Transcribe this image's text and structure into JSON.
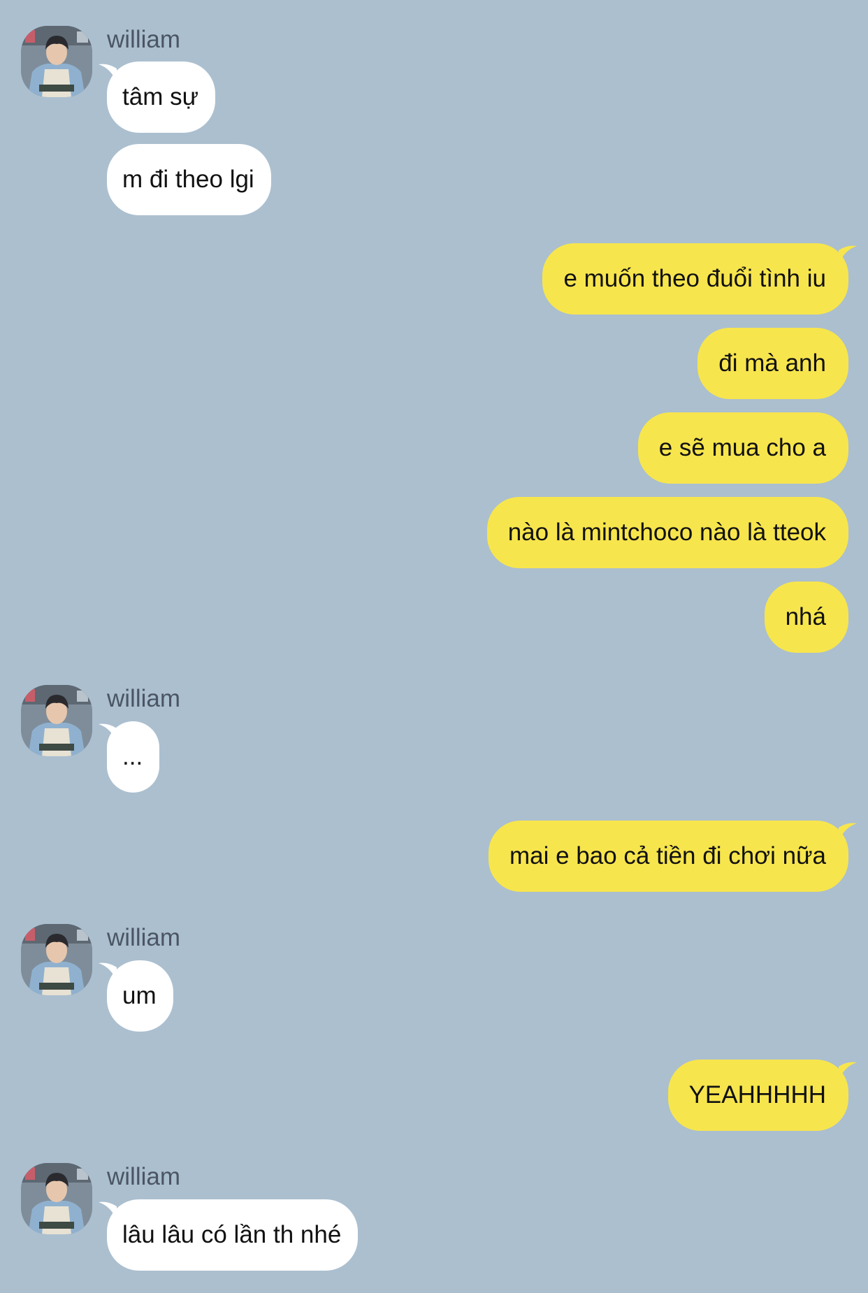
{
  "contact": {
    "name": "william",
    "avatar_icon": "profile-photo"
  },
  "colors": {
    "background": "#abbfcf",
    "incoming_bubble": "#ffffff",
    "outgoing_bubble": "#f7e54d",
    "sender_name": "#4b5563"
  },
  "messages": [
    {
      "direction": "in",
      "sender": "william",
      "text": "tâm sự"
    },
    {
      "direction": "in",
      "text": "m đi theo lgi"
    },
    {
      "direction": "out",
      "text": "e muốn theo đuổi tình iu"
    },
    {
      "direction": "out",
      "text": "đi mà anh"
    },
    {
      "direction": "out",
      "text": "e sẽ mua cho a"
    },
    {
      "direction": "out",
      "text": "nào là mintchoco nào là tteok"
    },
    {
      "direction": "out",
      "text": "nhá"
    },
    {
      "direction": "in",
      "sender": "william",
      "text": "..."
    },
    {
      "direction": "out",
      "text": "mai e bao cả tiền đi chơi nữa"
    },
    {
      "direction": "in",
      "sender": "william",
      "text": "um"
    },
    {
      "direction": "out",
      "text": "YEAHHHHH"
    },
    {
      "direction": "in",
      "sender": "william",
      "text": "lâu lâu có lần th nhé"
    }
  ]
}
